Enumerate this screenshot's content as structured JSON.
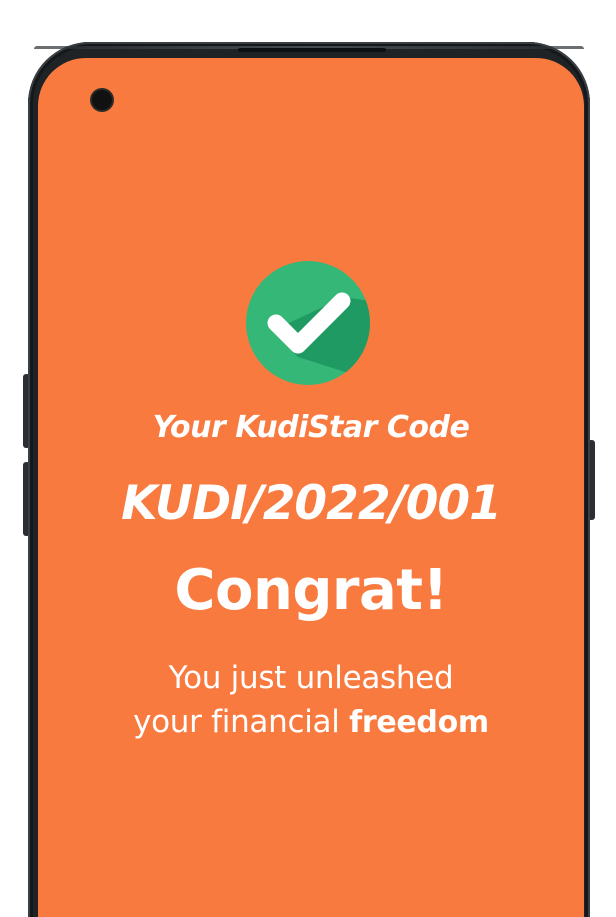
{
  "screen": {
    "background_color": "#f87a3f",
    "status_icon": "check-circle-icon",
    "code_label": "Your KudiStar Code",
    "code_value": "KUDI/2022/001",
    "headline": "Congrat!",
    "message_line1": "You just unleashed",
    "message_line2_prefix": "your financial ",
    "message_line2_emphasis": "freedom"
  },
  "colors": {
    "accent_orange": "#f87a3f",
    "check_green": "#35b778",
    "check_shadow": "#1f9a63",
    "text": "#ffffff"
  }
}
